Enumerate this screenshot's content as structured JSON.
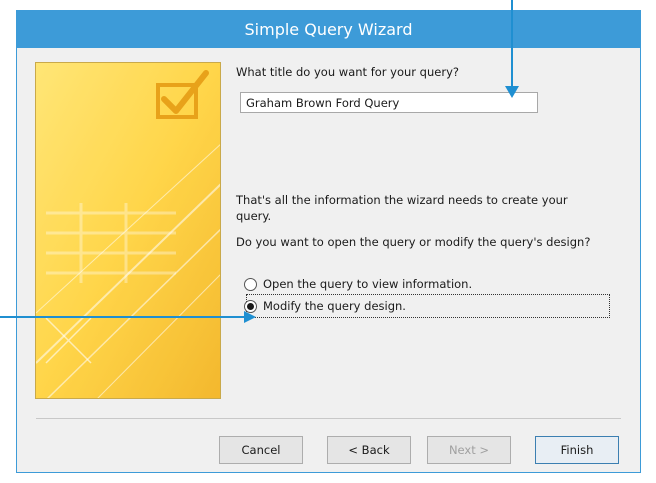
{
  "dialog": {
    "title": "Simple Query Wizard",
    "accent_color": "#3d9bd8"
  },
  "form": {
    "title_prompt": "What title do you want for your query?",
    "title_value": "Graham Brown Ford Query",
    "info_line1": "That's all the information the wizard needs to create your",
    "info_line2": "query.",
    "question": "Do you want to open the query or modify the query's design?",
    "options": [
      {
        "label": "Open the query to view information.",
        "selected": false
      },
      {
        "label": "Modify the query design.",
        "selected": true
      }
    ]
  },
  "buttons": {
    "cancel": "Cancel",
    "back": "< Back",
    "next": "Next >",
    "finish": "Finish"
  },
  "icons": [
    "wizard-checkmark-icon",
    "radio-icon"
  ],
  "callout_color": "#1f8fd1"
}
